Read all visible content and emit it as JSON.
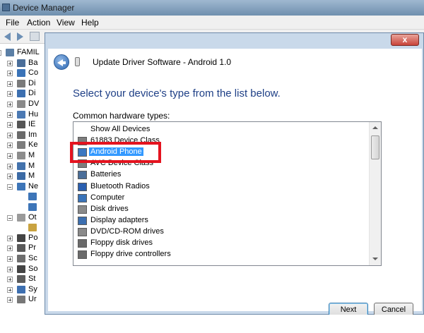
{
  "device_manager": {
    "title": "Device Manager",
    "menu": [
      "File",
      "Action",
      "View",
      "Help"
    ],
    "tree": [
      {
        "label": "FAMIL",
        "expander": "minus",
        "color": "#5b7fa6"
      },
      {
        "label": "Ba",
        "expander": "plus",
        "color": "#4a6e99"
      },
      {
        "label": "Co",
        "expander": "plus",
        "color": "#3a73b8"
      },
      {
        "label": "Di",
        "expander": "plus",
        "color": "#7a7a7a"
      },
      {
        "label": "Di",
        "expander": "plus",
        "color": "#3c6fb0"
      },
      {
        "label": "DV",
        "expander": "plus",
        "color": "#8a8a8a"
      },
      {
        "label": "Hu",
        "expander": "plus",
        "color": "#4b79b3"
      },
      {
        "label": "IE",
        "expander": "plus",
        "color": "#555555"
      },
      {
        "label": "Im",
        "expander": "plus",
        "color": "#6a6a6a"
      },
      {
        "label": "Ke",
        "expander": "plus",
        "color": "#7c7c7c"
      },
      {
        "label": "M",
        "expander": "plus",
        "color": "#8c8c8c"
      },
      {
        "label": "M",
        "expander": "plus",
        "color": "#4372ac"
      },
      {
        "label": "M",
        "expander": "plus",
        "color": "#3b6aa5"
      },
      {
        "label": "Ne",
        "expander": "minus",
        "color": "#3d75b8"
      },
      {
        "label": "",
        "expander": "",
        "color": "#3d75b8"
      },
      {
        "label": "",
        "expander": "",
        "color": "#3d75b8"
      },
      {
        "label": "Ot",
        "expander": "minus",
        "color": "#9a9a9a"
      },
      {
        "label": "",
        "expander": "",
        "color": "#c9a341"
      },
      {
        "label": "Po",
        "expander": "plus",
        "color": "#444444"
      },
      {
        "label": "Pr",
        "expander": "plus",
        "color": "#5a5a5a"
      },
      {
        "label": "Sc",
        "expander": "plus",
        "color": "#6e6e6e"
      },
      {
        "label": "So",
        "expander": "plus",
        "color": "#444444"
      },
      {
        "label": "St",
        "expander": "plus",
        "color": "#5c5c5c"
      },
      {
        "label": "Sy",
        "expander": "plus",
        "color": "#3d6fb0"
      },
      {
        "label": "Ur",
        "expander": "plus",
        "color": "#777777"
      }
    ]
  },
  "dialog": {
    "close_label": "x",
    "header_title": "Update Driver Software - Android 1.0",
    "main_instruction": "Select your device's type from the list below.",
    "list_label": "Common hardware types:",
    "items": [
      {
        "label": "Show All Devices",
        "icon": "none",
        "color": "#ffffff"
      },
      {
        "label": "61883 Device Class",
        "icon": "device-class-icon",
        "color": "#7d7d7d"
      },
      {
        "label": "Android Phone",
        "icon": "android-phone-icon",
        "color": "#3a78c2",
        "selected": true
      },
      {
        "label": "AVC Device Class",
        "icon": "avc-icon",
        "color": "#7d7d7d"
      },
      {
        "label": "Batteries",
        "icon": "battery-icon",
        "color": "#4a6e99"
      },
      {
        "label": "Bluetooth Radios",
        "icon": "bluetooth-icon",
        "color": "#2a5fb0"
      },
      {
        "label": "Computer",
        "icon": "computer-icon",
        "color": "#3a73b8"
      },
      {
        "label": "Disk drives",
        "icon": "disk-icon",
        "color": "#8a8a8a"
      },
      {
        "label": "Display adapters",
        "icon": "display-icon",
        "color": "#3c6fb0"
      },
      {
        "label": "DVD/CD-ROM drives",
        "icon": "dvd-icon",
        "color": "#8a8a8a"
      },
      {
        "label": "Floppy disk drives",
        "icon": "floppy-icon",
        "color": "#6a6a6a"
      },
      {
        "label": "Floppy drive controllers",
        "icon": "floppy-controller-icon",
        "color": "#6a6a6a"
      }
    ],
    "buttons": {
      "next": "Next",
      "cancel": "Cancel"
    }
  },
  "colors": {
    "selection": "#3399ff",
    "highlight_box": "#e4131f",
    "instruction_text": "#1e3f86"
  }
}
